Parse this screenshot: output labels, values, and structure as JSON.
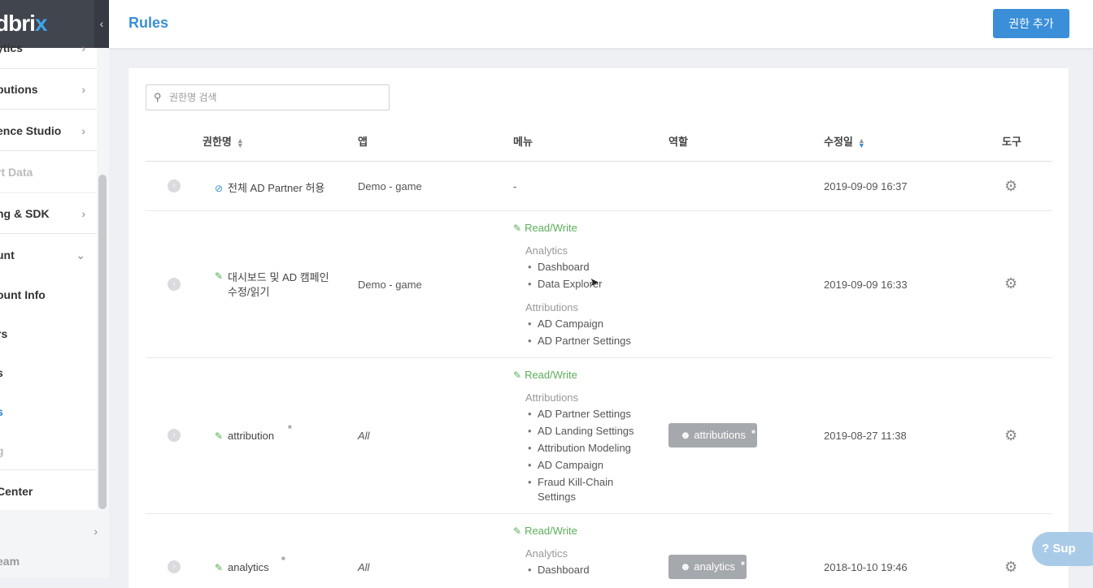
{
  "brand": {
    "logo_main": "dbri",
    "logo_x": "x"
  },
  "sidebar": {
    "collapse": "‹",
    "items": [
      {
        "label": "ytics",
        "chev": "›"
      },
      {
        "label": "butions",
        "chev": "›"
      },
      {
        "label": "ence Studio",
        "chev": "›"
      },
      {
        "label": "rt Data"
      },
      {
        "label": "ng & SDK",
        "chev": "›"
      },
      {
        "label": "unt",
        "chev": "⌄"
      },
      {
        "label": "ount Info"
      },
      {
        "label": "rs"
      },
      {
        "label": "s"
      },
      {
        "label": "s"
      },
      {
        "label": "g"
      },
      {
        "label": "Center"
      },
      {
        "label": "",
        "chev": "›"
      },
      {
        "label": "eam"
      }
    ]
  },
  "header": {
    "title": "Rules",
    "add_button": "권한 추가"
  },
  "search": {
    "placeholder": "권한명 검색",
    "icon": "search-icon"
  },
  "table": {
    "columns": {
      "name": "권한명",
      "app": "앱",
      "menu": "메뉴",
      "role": "역할",
      "modified": "수정일",
      "tools": "도구"
    },
    "rows": [
      {
        "name": "전체 AD Partner 허용",
        "app": "Demo - game",
        "menu_dash": "-",
        "date": "2019-09-09 16:37"
      },
      {
        "name_line1": "대시보드 및 AD 캠페인",
        "name_line2": "수정/읽기",
        "app": "Demo - game",
        "perm": "Read/Write",
        "groups": [
          {
            "title": "Analytics",
            "items": [
              "Dashboard",
              "Data Explorer"
            ]
          },
          {
            "title": "Attributions",
            "items": [
              "AD Campaign",
              "AD Partner Settings"
            ]
          }
        ],
        "date": "2019-09-09 16:33"
      },
      {
        "name": "attribution",
        "app": "All",
        "perm": "Read/Write",
        "groups": [
          {
            "title": "Attributions",
            "items": [
              "AD Partner Settings",
              "AD Landing Settings",
              "Attribution Modeling",
              "AD Campaign",
              "Fraud Kill-Chain",
              "Settings"
            ]
          }
        ],
        "role": "attributions",
        "date": "2019-08-27 11:38"
      },
      {
        "name": "analytics",
        "app": "All",
        "perm": "Read/Write",
        "groups": [
          {
            "title": "Analytics",
            "items": [
              "Dashboard"
            ]
          }
        ],
        "role": "analytics",
        "date": "2018-10-10 19:46"
      }
    ]
  },
  "support": {
    "label": "Sup"
  }
}
